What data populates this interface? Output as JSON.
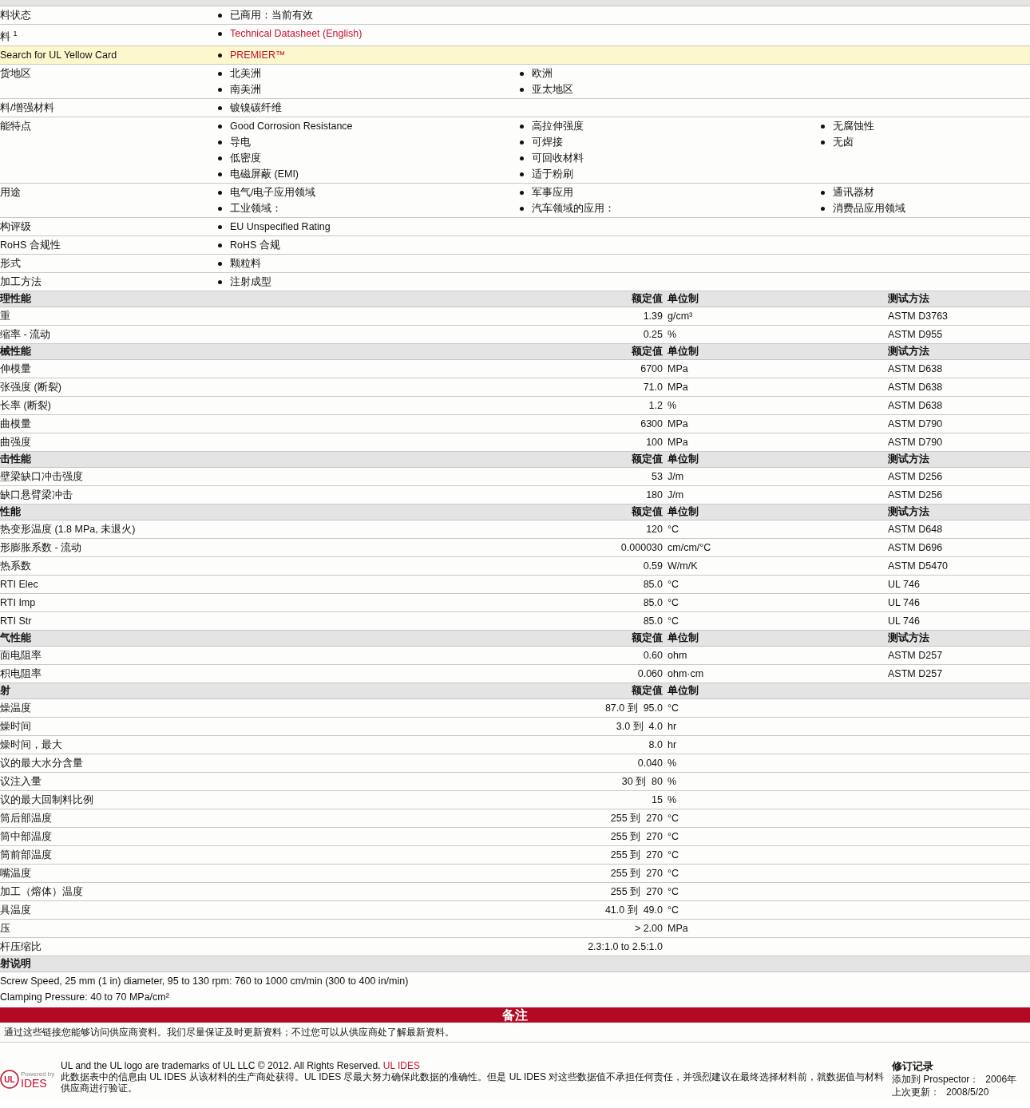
{
  "general": [
    {
      "label": "料状态",
      "highlighted": false,
      "link": false,
      "columns": [
        [
          "已商用：当前有效"
        ]
      ]
    },
    {
      "label": "料 $^{1}$",
      "highlighted": false,
      "link": true,
      "columns": [
        [
          "Technical Datasheet (English)"
        ]
      ]
    },
    {
      "label": "Search for UL Yellow Card",
      "highlighted": true,
      "link": true,
      "columns": [
        [
          "PREMIER™"
        ]
      ]
    },
    {
      "label": "货地区",
      "highlighted": false,
      "link": false,
      "columns": [
        [
          "北美洲",
          "南美洲"
        ],
        [
          "欧洲",
          "亚太地区"
        ]
      ]
    },
    {
      "label": "料/增强材料",
      "highlighted": false,
      "link": false,
      "columns": [
        [
          "镀镍碳纤维"
        ]
      ]
    },
    {
      "label": "能特点",
      "highlighted": false,
      "link": false,
      "columns": [
        [
          "Good Corrosion Resistance",
          "导电",
          "低密度",
          "电磁屏蔽 (EMI)"
        ],
        [
          "高拉伸强度",
          "可焊接",
          "可回收材料",
          "适于粉刷"
        ],
        [
          "无腐蚀性",
          "无卤"
        ]
      ]
    },
    {
      "label": "用途",
      "highlighted": false,
      "link": false,
      "columns": [
        [
          "电气/电子应用领域",
          "工业领域："
        ],
        [
          "军事应用",
          "汽车领域的应用："
        ],
        [
          "通讯器材",
          "消费品应用领域"
        ]
      ]
    },
    {
      "label": "构评级",
      "highlighted": false,
      "link": false,
      "columns": [
        [
          "EU Unspecified Rating"
        ]
      ]
    },
    {
      "label": "RoHS 合规性",
      "highlighted": false,
      "link": false,
      "columns": [
        [
          "RoHS 合规"
        ]
      ]
    },
    {
      "label": "形式",
      "highlighted": false,
      "link": false,
      "columns": [
        [
          "颗粒料"
        ]
      ]
    },
    {
      "label": "加工方法",
      "highlighted": false,
      "link": false,
      "columns": [
        [
          "注射成型"
        ]
      ]
    }
  ],
  "sections": [
    {
      "title": "理性能",
      "headers": [
        "额定值",
        "单位制",
        "测试方法"
      ],
      "rows": [
        {
          "label": "重",
          "value": "1.39",
          "unit": "g/cm³",
          "method": "ASTM D3763"
        },
        {
          "label": "缩率 - 流动",
          "value": "0.25",
          "unit": "%",
          "method": "ASTM D955"
        }
      ]
    },
    {
      "title": "械性能",
      "headers": [
        "额定值",
        "单位制",
        "测试方法"
      ],
      "rows": [
        {
          "label": "伸模量",
          "value": "6700",
          "unit": "MPa",
          "method": "ASTM D638"
        },
        {
          "label": "张强度 (断裂)",
          "value": "71.0",
          "unit": "MPa",
          "method": "ASTM D638"
        },
        {
          "label": "长率 (断裂)",
          "value": "1.2",
          "unit": "%",
          "method": "ASTM D638"
        },
        {
          "label": "曲模量",
          "value": "6300",
          "unit": "MPa",
          "method": "ASTM D790"
        },
        {
          "label": "曲强度",
          "value": "100",
          "unit": "MPa",
          "method": "ASTM D790"
        }
      ]
    },
    {
      "title": "击性能",
      "headers": [
        "额定值",
        "单位制",
        "测试方法"
      ],
      "rows": [
        {
          "label": "壁梁缺口冲击强度",
          "value": "53",
          "unit": "J/m",
          "method": "ASTM D256"
        },
        {
          "label": "缺口悬臂梁冲击",
          "value": "180",
          "unit": "J/m",
          "method": "ASTM D256"
        }
      ]
    },
    {
      "title": "性能",
      "headers": [
        "额定值",
        "单位制",
        "测试方法"
      ],
      "rows": [
        {
          "label": "热变形温度 (1.8 MPa, 未退火)",
          "value": "120",
          "unit": "°C",
          "method": "ASTM D648"
        },
        {
          "label": "形膨胀系数 - 流动",
          "value": "0.000030",
          "unit": "cm/cm/°C",
          "method": "ASTM D696"
        },
        {
          "label": "热系数",
          "value": "0.59",
          "unit": "W/m/K",
          "method": "ASTM D5470"
        },
        {
          "label": "RTI Elec",
          "value": "85.0",
          "unit": "°C",
          "method": "UL 746"
        },
        {
          "label": "RTI Imp",
          "value": "85.0",
          "unit": "°C",
          "method": "UL 746"
        },
        {
          "label": "RTI Str",
          "value": "85.0",
          "unit": "°C",
          "method": "UL 746"
        }
      ]
    },
    {
      "title": "气性能",
      "headers": [
        "额定值",
        "单位制",
        "测试方法"
      ],
      "rows": [
        {
          "label": "面电阻率",
          "value": "0.60",
          "unit": "ohm",
          "method": "ASTM D257"
        },
        {
          "label": "积电阻率",
          "value": "0.060",
          "unit": "ohm·cm",
          "method": "ASTM D257"
        }
      ]
    },
    {
      "title": "射",
      "headers": [
        "额定值",
        "单位制"
      ],
      "rows": [
        {
          "label": "燥温度",
          "value": "87.0 到  95.0",
          "unit": "°C"
        },
        {
          "label": "燥时间",
          "value": "3.0 到  4.0",
          "unit": "hr"
        },
        {
          "label": "燥时间，最大",
          "value": "8.0",
          "unit": "hr"
        },
        {
          "label": "议的最大水分含量",
          "value": "0.040",
          "unit": "%"
        },
        {
          "label": "议注入量",
          "value": "30 到  80",
          "unit": "%"
        },
        {
          "label": "议的最大回制料比例",
          "value": "15",
          "unit": "%"
        },
        {
          "label": "筒后部温度",
          "value": "255 到  270",
          "unit": "°C"
        },
        {
          "label": "筒中部温度",
          "value": "255 到  270",
          "unit": "°C"
        },
        {
          "label": "筒前部温度",
          "value": "255 到  270",
          "unit": "°C"
        },
        {
          "label": "嘴温度",
          "value": "255 到  270",
          "unit": "°C"
        },
        {
          "label": "加工（熔体）温度",
          "value": "255 到  270",
          "unit": "°C"
        },
        {
          "label": "具温度",
          "value": "41.0 到  49.0",
          "unit": "°C"
        },
        {
          "label": "压",
          "value": "> 2.00",
          "unit": "MPa"
        },
        {
          "label": "杆压缩比",
          "value": "2.3:1.0 to 2.5:1.0"
        }
      ]
    }
  ],
  "injection_notes": {
    "title": "射说明",
    "lines": [
      "Screw Speed, 25 mm (1 in) diameter, 95 to 130 rpm: 760 to 1000 cm/min (300 to 400 in/min)",
      "Clamping Pressure: 40 to 70 MPa/cm²"
    ]
  },
  "remarks": {
    "title": "备注",
    "text": "通过这些链接您能够访问供应商资料。我们尽量保证及时更新资料；不过您可以从供应商处了解最新资料。"
  },
  "footer": {
    "logo": {
      "mark": "UL",
      "powered": "Powered by",
      "name": "IDES"
    },
    "trademark": "UL and the UL logo are trademarks of UL LLC © 2012. All Rights Reserved.",
    "trademark_link": "UL IDES",
    "disclaimer": "此数据表中的信息由  UL IDES 从该材料的生产商处获得。UL IDES 尽最大努力确保此数据的准确性。但是  UL IDES 对这些数据值不承担任何责任，并强烈建议在最终选择材料前，就数据值与材料供应商进行验证。",
    "revision": {
      "title": "修订记录",
      "entries": [
        {
          "label": "添加到  Prospector：",
          "value": "2006年"
        },
        {
          "label": "上次更新：",
          "value": "2008/5/20"
        }
      ]
    }
  }
}
